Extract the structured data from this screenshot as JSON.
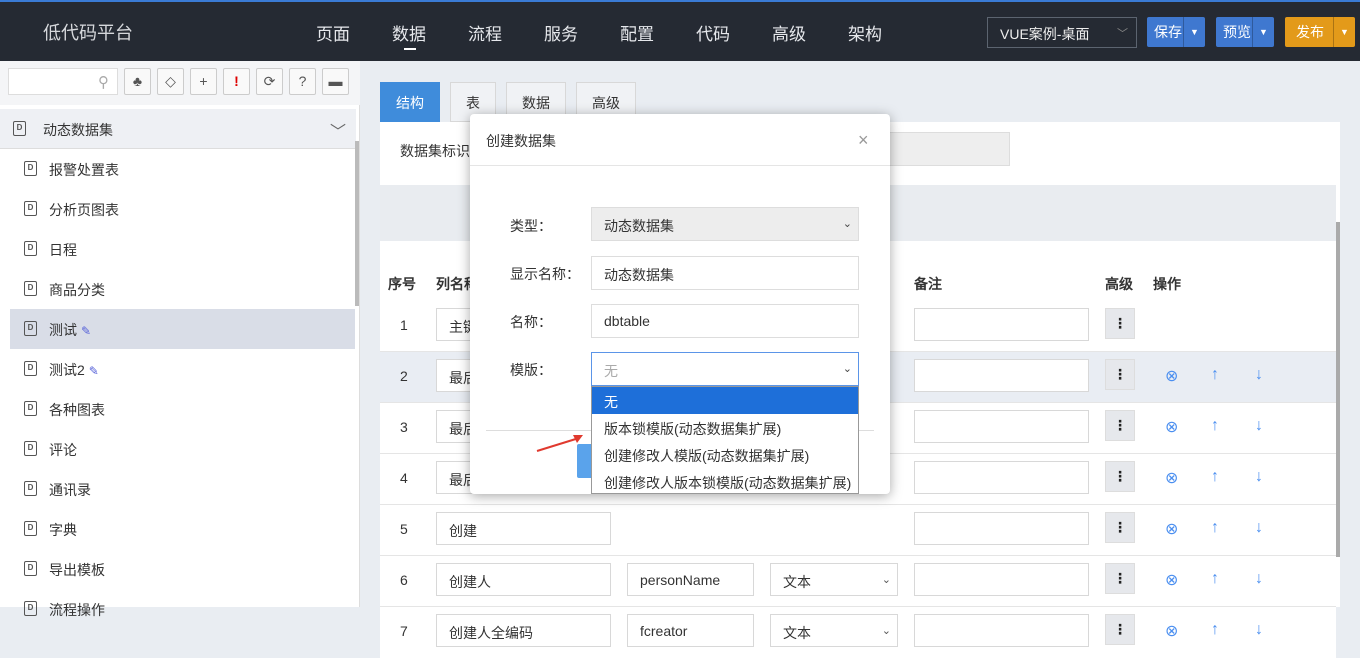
{
  "topbar": {
    "brand": "低代码平台",
    "nav": [
      "页面",
      "数据",
      "流程",
      "服务",
      "配置",
      "代码",
      "高级",
      "架构"
    ],
    "active_nav": "数据",
    "project_select": "VUE案例-桌面",
    "save_label": "保存",
    "preview_label": "预览",
    "publish_label": "发布",
    "colors": {
      "bar": "#252a33",
      "save": "#3f78d0",
      "preview": "#3f78d0",
      "publish": "#e39a1a"
    }
  },
  "sidebar": {
    "search_placeholder": "",
    "tools": [
      {
        "icon": "tree-icon",
        "glyph": "♣"
      },
      {
        "icon": "tag-icon",
        "glyph": "◇"
      },
      {
        "icon": "add-icon",
        "glyph": "+"
      },
      {
        "icon": "alert-icon",
        "glyph": "!"
      },
      {
        "icon": "refresh-icon",
        "glyph": "⟳"
      },
      {
        "icon": "help-icon",
        "glyph": "?"
      },
      {
        "icon": "chat-icon",
        "glyph": "▬"
      }
    ],
    "group_title": "动态数据集",
    "items": [
      {
        "label": "报警处置表"
      },
      {
        "label": "分析页图表"
      },
      {
        "label": "日程"
      },
      {
        "label": "商品分类"
      },
      {
        "label": "测试",
        "editable": true,
        "selected": true
      },
      {
        "label": "测试2",
        "editable": true
      },
      {
        "label": "各种图表"
      },
      {
        "label": "评论"
      },
      {
        "label": "通讯录"
      },
      {
        "label": "字典"
      },
      {
        "label": "导出模板"
      },
      {
        "label": "流程操作"
      }
    ]
  },
  "main": {
    "tabs": [
      "结构",
      "表",
      "数据",
      "高级"
    ],
    "active_tab": "结构",
    "dataset_id_label": "数据集标识",
    "headers": {
      "index": "序号",
      "colname": "列名称",
      "note": "备注",
      "advanced": "高级",
      "action": "操作"
    },
    "rows": [
      {
        "index": "1",
        "name": "主键",
        "field": "",
        "type": ""
      },
      {
        "index": "2",
        "name": "最后",
        "field": "",
        "type": ""
      },
      {
        "index": "3",
        "name": "最后",
        "field": "",
        "type": ""
      },
      {
        "index": "4",
        "name": "最后",
        "field": "",
        "type": ""
      },
      {
        "index": "5",
        "name": "创建",
        "field": "",
        "type": ""
      },
      {
        "index": "6",
        "name": "创建人",
        "field": "personName",
        "type": "文本"
      },
      {
        "index": "7",
        "name": "创建人全编码",
        "field": "fcreator",
        "type": "文本"
      }
    ]
  },
  "modal": {
    "title": "创建数据集",
    "close": "×",
    "type_label": "类型：",
    "type_value": "动态数据集",
    "display_name_label": "显示名称：",
    "display_name_value": "动态数据集",
    "name_label": "名称：",
    "name_value": "dbtable",
    "template_label": "模版：",
    "template_value": "无",
    "template_options": [
      "无",
      "版本锁模版(动态数据集扩展)",
      "创建修改人模版(动态数据集扩展)",
      "创建修改人版本锁模版(动态数据集扩展)"
    ],
    "template_selected_index": 0
  }
}
